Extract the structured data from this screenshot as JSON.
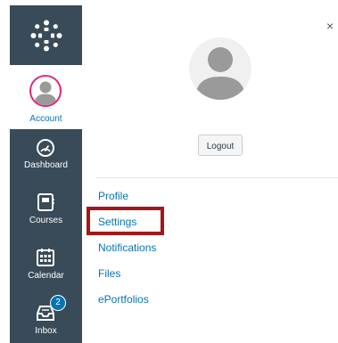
{
  "nav": {
    "logo_icon": "canvas-logo-icon",
    "account": {
      "label": "Account",
      "icon": "user-avatar-icon"
    },
    "items": [
      {
        "label": "Dashboard",
        "icon": "dashboard-gauge-icon"
      },
      {
        "label": "Courses",
        "icon": "book-icon"
      },
      {
        "label": "Calendar",
        "icon": "calendar-icon"
      },
      {
        "label": "Inbox",
        "icon": "inbox-icon",
        "badge": "2"
      }
    ]
  },
  "tray": {
    "close_label": "×",
    "logout_label": "Logout",
    "links": [
      {
        "label": "Profile"
      },
      {
        "label": "Settings",
        "highlighted": true
      },
      {
        "label": "Notifications"
      },
      {
        "label": "Files"
      },
      {
        "label": "ePortfolios"
      }
    ]
  },
  "colors": {
    "nav_background": "#394b58",
    "link": "#0374b5",
    "account_ring": "#e0277f",
    "highlight": "#a31818",
    "badge": "#0374b5"
  }
}
